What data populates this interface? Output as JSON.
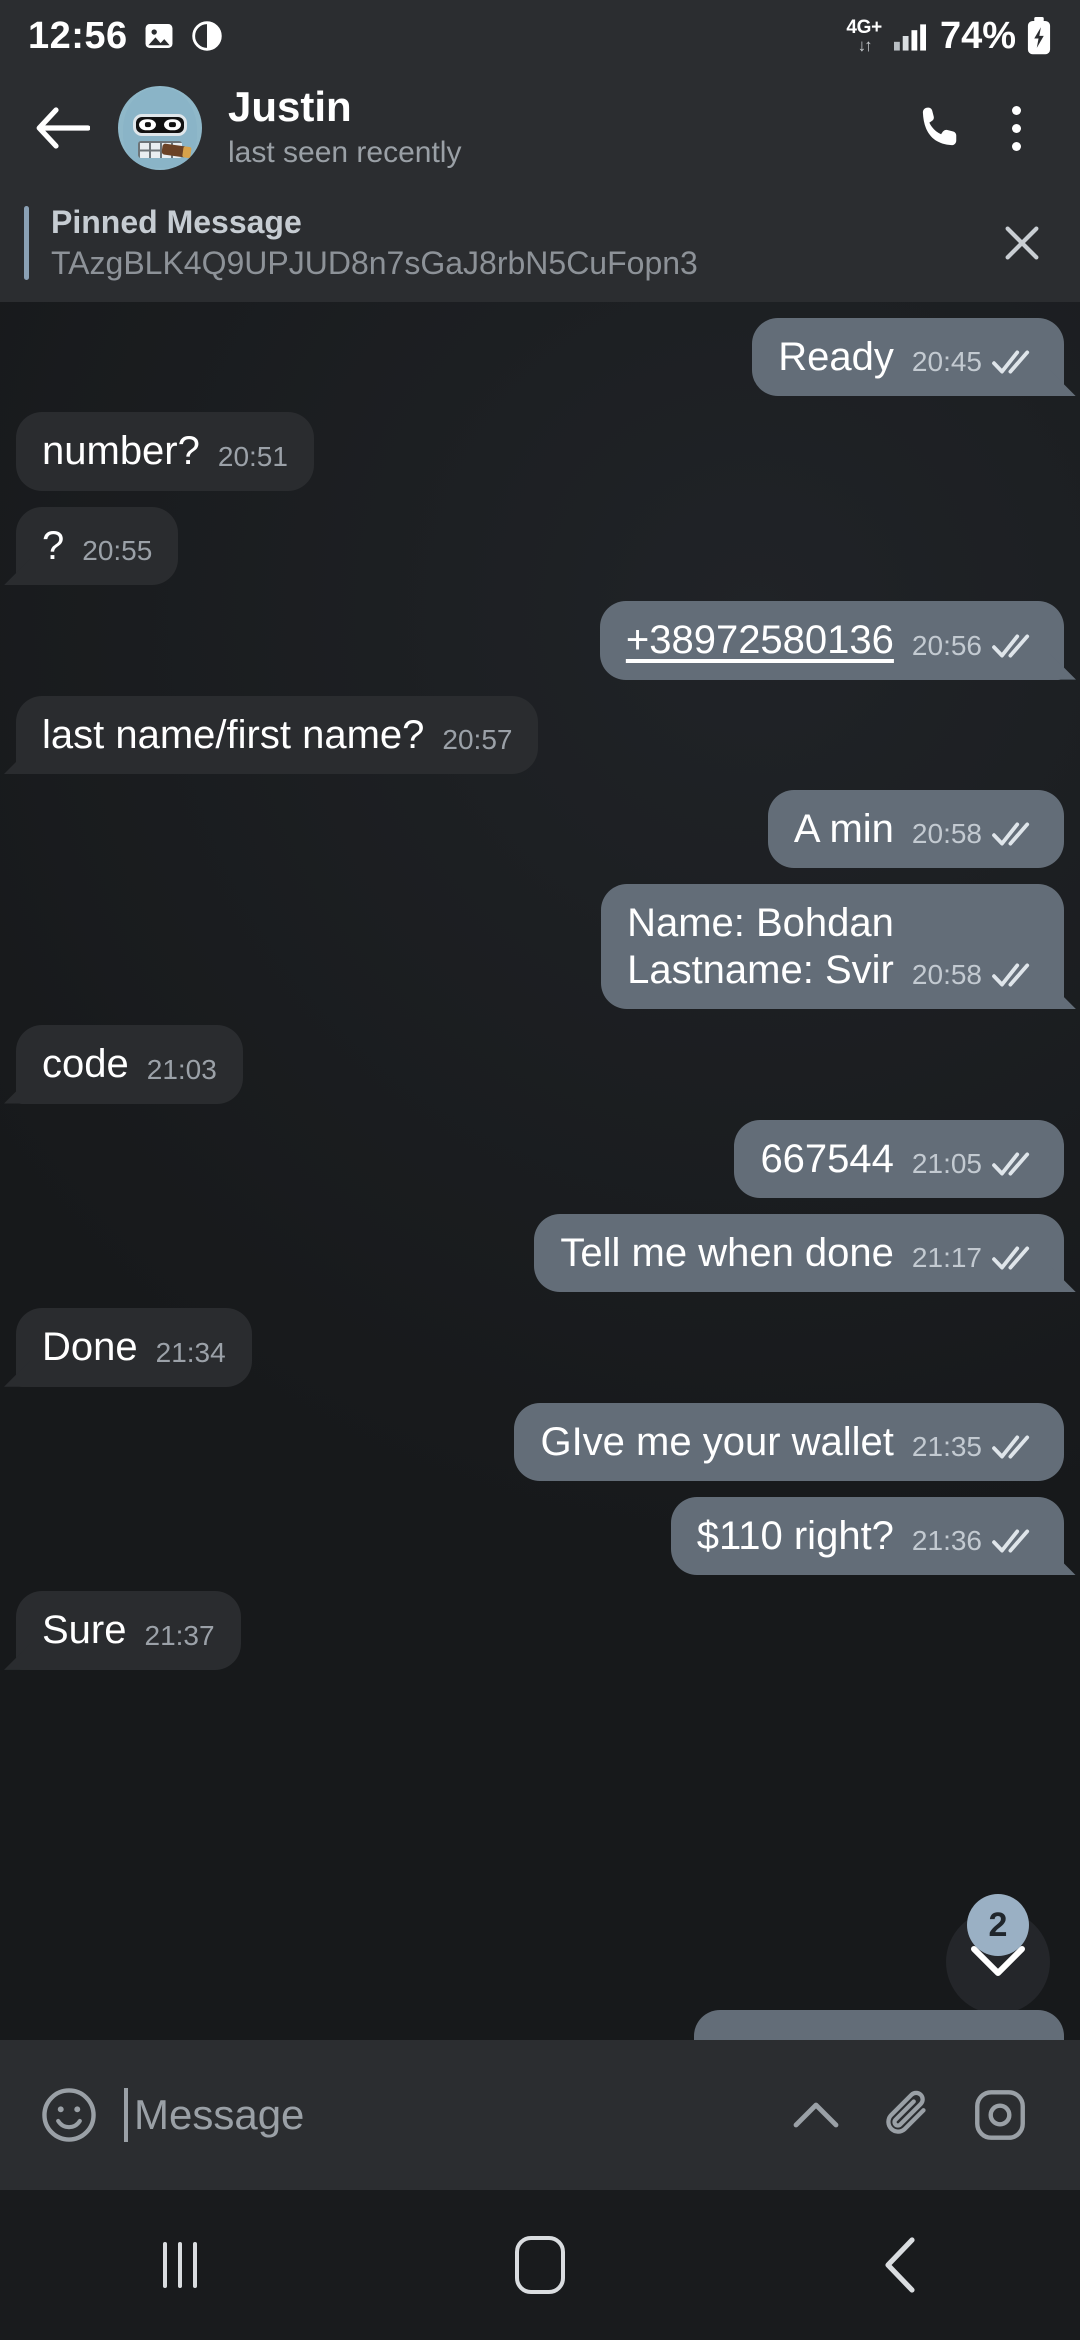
{
  "status_bar": {
    "time": "12:56",
    "network_type": "4G+",
    "battery_percent": "74%",
    "icons": [
      "image-icon",
      "do-not-disturb-icon",
      "data-transfer-icon",
      "signal-bars-icon",
      "battery-charging-icon"
    ]
  },
  "header": {
    "back_label": "Back",
    "contact_name": "Justin",
    "status_text": "last seen recently",
    "call_label": "Call",
    "menu_label": "More options"
  },
  "pinned": {
    "title": "Pinned Message",
    "text": "TAzgBLK4Q9UPJUD8n7sGaJ8rbN5CuFopn3",
    "close_label": "Close"
  },
  "messages": [
    {
      "id": 1,
      "text": "Ready",
      "time": "20:45",
      "dir": "out",
      "status": "read",
      "tail": true
    },
    {
      "id": 2,
      "text": "number?",
      "time": "20:51",
      "dir": "in",
      "tail": false
    },
    {
      "id": 3,
      "text": "?",
      "time": "20:55",
      "dir": "in",
      "tail": true
    },
    {
      "id": 4,
      "text": "+38972580136",
      "time": "20:56",
      "dir": "out",
      "status": "read",
      "tail": true,
      "link": true
    },
    {
      "id": 5,
      "text": "last name/first name?",
      "time": "20:57",
      "dir": "in",
      "tail": true
    },
    {
      "id": 6,
      "text": "A min",
      "time": "20:58",
      "dir": "out",
      "status": "read",
      "tail": false
    },
    {
      "id": 7,
      "text": "Name: Bohdan\nLastname: Svir",
      "time": "20:58",
      "dir": "out",
      "status": "read",
      "tail": true
    },
    {
      "id": 8,
      "text": "code",
      "time": "21:03",
      "dir": "in",
      "tail": true
    },
    {
      "id": 9,
      "text": "667544",
      "time": "21:05",
      "dir": "out",
      "status": "read",
      "tail": false
    },
    {
      "id": 10,
      "text": "Tell me when done",
      "time": "21:17",
      "dir": "out",
      "status": "read",
      "tail": true
    },
    {
      "id": 11,
      "text": "Done",
      "time": "21:34",
      "dir": "in",
      "tail": true
    },
    {
      "id": 12,
      "text": "GIve me your wallet",
      "time": "21:35",
      "dir": "out",
      "status": "read",
      "tail": false
    },
    {
      "id": 13,
      "text": "$110 right?",
      "time": "21:36",
      "dir": "out",
      "status": "read",
      "tail": true
    },
    {
      "id": 14,
      "text": "Sure",
      "time": "21:37",
      "dir": "in",
      "tail": true
    }
  ],
  "scroll_button": {
    "unread_count": "2",
    "icon": "chevron-down-icon"
  },
  "input_bar": {
    "placeholder": "Message",
    "value": "",
    "emoji_label": "Emoji",
    "expand_label": "Expand",
    "attach_label": "Attach",
    "camera_label": "Camera"
  },
  "nav_bar": {
    "recents_label": "Recents",
    "home_label": "Home",
    "back_label": "Back"
  },
  "colors": {
    "background": "#17191b",
    "panel": "#2b2d30",
    "outgoing_bubble": "#636d78",
    "incoming_bubble": "#2a2c2f",
    "accent": "#9ab0c4",
    "text": "#ffffff",
    "muted_text": "#9aa0a6"
  }
}
